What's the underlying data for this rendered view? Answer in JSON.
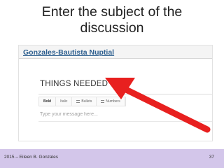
{
  "slide": {
    "title_line1": "Enter the subject of the",
    "title_line2": "discussion"
  },
  "app": {
    "group_title": "Gonzales-Bautista Nuptial",
    "subject_value": "THINGS NEEDED",
    "toolbar": [
      "Bold",
      "Italic",
      "Bullets",
      "Numbers"
    ],
    "message_placeholder": "Type your message here...",
    "message_value": ""
  },
  "annotation": {
    "arrow_color": "#e8201f",
    "arrow_points_to": "subject-input"
  },
  "footer": {
    "left": "2015 – Eileen B. Gonzales",
    "page_number": "37"
  },
  "colors": {
    "footer_background": "#d3c6ea",
    "group_title": "#2d5f8f"
  }
}
